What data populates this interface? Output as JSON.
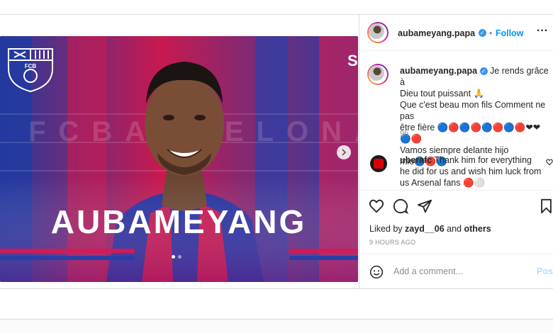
{
  "post": {
    "author": "aubameyang.papa",
    "follow_label": "Follow",
    "dot": "•",
    "more_label": "···",
    "caption_lines": [
      "Je rends grâce à",
      "Dieu tout puissant 🙏",
      "Que c'est beau mon fils Comment ne pas",
      "être fière 🔵🔴🔵🔴🔵🔴🔵🔴❤❤🔵🔴",
      "Vamos siempre delante hijo mio🔵🔴🔵"
    ],
    "caption_time": "9h",
    "comment": {
      "author": "uberafc",
      "lines": [
        "Thank him for everything",
        "he did for us and wish him luck from",
        "us Arsenal fans 🔴⚪"
      ]
    },
    "liked_by_prefix": "Liked by",
    "liked_by_user": "zayd__06",
    "liked_by_and": "and",
    "liked_by_others": "others",
    "timestamp": "9 HOURS AGO",
    "comment_placeholder": "Add a comment...",
    "post_button": "Post",
    "carousel_dots": 2
  },
  "media": {
    "banner_text": "AUBAMEYANG",
    "background_text": "FCBARCELONA",
    "crest_text": "FCB",
    "partial_text": "S",
    "colors": {
      "blue": "#2c3ea3",
      "red": "#d6184f",
      "magenta": "#c2185b",
      "white": "#ffffff"
    }
  },
  "icons": [
    "more-icon",
    "verified-icon",
    "heart-icon",
    "comment-icon",
    "share-icon",
    "bookmark-icon",
    "emoji-icon",
    "next-arrow-icon"
  ]
}
